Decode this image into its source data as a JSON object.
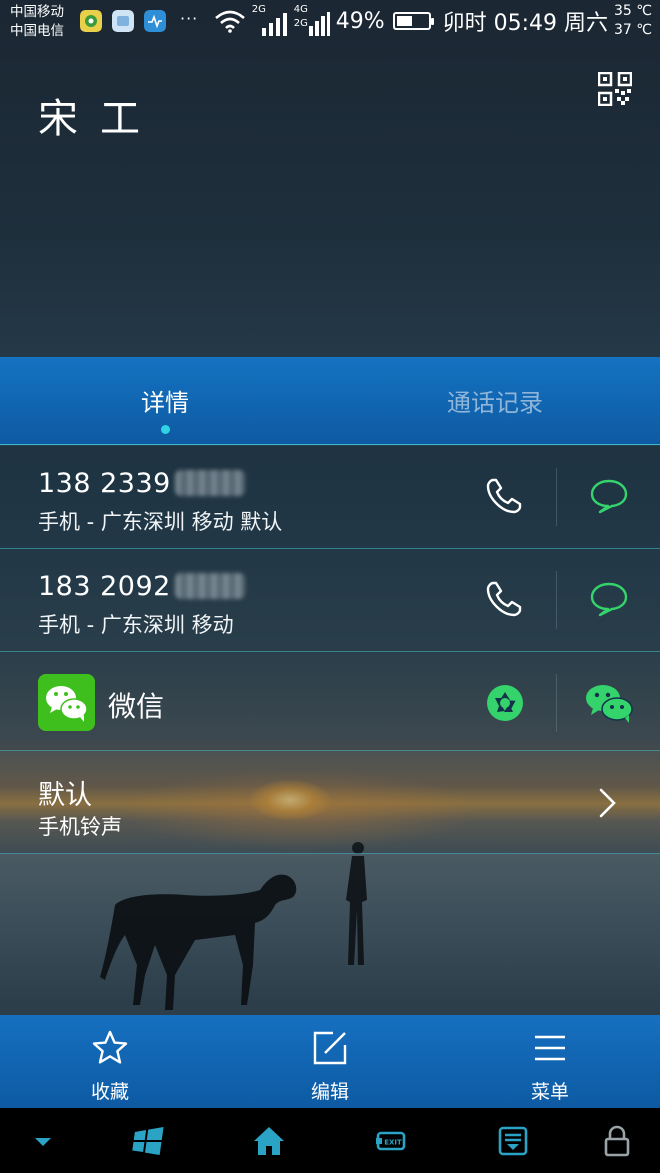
{
  "status_bar": {
    "carrier_1": "中国移动",
    "carrier_2": "中国电信",
    "more": "···",
    "network_1": "2G",
    "network_2": "4G",
    "network_3": "2G",
    "battery": "49%",
    "battery_level": 0.49,
    "clock": "卯时 05:49 周六",
    "temp_high": "35 ℃",
    "temp_low": "37 ℃"
  },
  "contact": {
    "name": "宋工"
  },
  "tabs": [
    {
      "label": "详情",
      "active": true
    },
    {
      "label": "通话记录",
      "active": false
    }
  ],
  "phones": [
    {
      "number": "138 2339",
      "detail": "手机 - 广东深圳 移动 默认"
    },
    {
      "number": "183 2092",
      "detail": "手机 - 广东深圳 移动"
    }
  ],
  "wechat": {
    "label": "微信"
  },
  "ringtone": {
    "title": "默认",
    "subtitle": "手机铃声"
  },
  "actions": [
    {
      "label": "收藏",
      "icon": "star-icon"
    },
    {
      "label": "编辑",
      "icon": "edit-icon"
    },
    {
      "label": "菜单",
      "icon": "menu-icon"
    }
  ],
  "nav": {
    "exit_label": "EXIT"
  },
  "colors": {
    "tab_bar": "#1473c2",
    "accent_green": "#35d36b",
    "wechat_green": "#3fbf1d",
    "indicator": "#2fd3e6"
  }
}
